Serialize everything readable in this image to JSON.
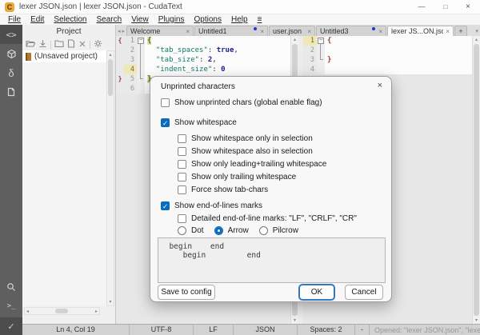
{
  "window": {
    "title": "lexer JSON.json | lexer JSON.json - CudaText",
    "app_badge": "C",
    "controls": {
      "minimize": "—",
      "maximize": "□",
      "close": "×"
    }
  },
  "menu": {
    "items": [
      "File",
      "Edit",
      "Selection",
      "Search",
      "View",
      "Plugins",
      "Options",
      "Help",
      "≡"
    ]
  },
  "icons": {
    "up": "▴",
    "down": "▾",
    "left": "◂",
    "right": "▸",
    "close": "×",
    "plus": "+",
    "overflow": "▾",
    "fold_minus": "−",
    "code": "<>",
    "delta": "δ",
    "console": ">_",
    "list": "≡",
    "check": "✓"
  },
  "sidebar": {
    "top": [
      "code-icon",
      "package-icon",
      "delta-icon",
      "document-icon"
    ],
    "bottom": [
      "search-icon",
      "console-icon",
      "list-icon",
      "check-icon"
    ]
  },
  "project": {
    "title": "Project",
    "toolbar": [
      "open-project-icon",
      "import-icon",
      "new-folder-icon",
      "new-file-icon",
      "close-project-icon",
      "settings-icon"
    ],
    "items": [
      {
        "label": "(Unsaved project)",
        "selected": true
      }
    ]
  },
  "tabbar": {
    "tabs": [
      {
        "label": "Welcome",
        "modified": false,
        "active": false
      },
      {
        "label": "Untitled1",
        "modified": true,
        "active": false
      },
      {
        "label": "user.json",
        "modified": false,
        "active": false
      },
      {
        "label": "Untitled3",
        "modified": true,
        "active": false
      },
      {
        "label": "lexer JS...ON.json",
        "modified": false,
        "active": true
      }
    ]
  },
  "editor_left": {
    "numbers": [
      "1",
      "2",
      "3",
      "4",
      "5",
      "6"
    ],
    "current_line": "4",
    "show_marks": true,
    "gutter_marks": {
      "1": "{",
      "5": "}"
    },
    "lines": [
      [
        {
          "t": "{",
          "c": "brace"
        }
      ],
      [
        {
          "t": "  ",
          "c": "plain"
        },
        {
          "t": "\"tab_spaces\"",
          "c": "key"
        },
        {
          "t": ": ",
          "c": "punct"
        },
        {
          "t": "true",
          "c": "bool"
        },
        {
          "t": ",",
          "c": "punct"
        }
      ],
      [
        {
          "t": "  ",
          "c": "plain"
        },
        {
          "t": "\"tab_size\"",
          "c": "key"
        },
        {
          "t": ": ",
          "c": "punct"
        },
        {
          "t": "2",
          "c": "num"
        },
        {
          "t": ",",
          "c": "punct"
        }
      ],
      [
        {
          "t": "  ",
          "c": "plain"
        },
        {
          "t": "\"indent_size\"",
          "c": "key"
        },
        {
          "t": ": ",
          "c": "punct"
        },
        {
          "t": "0",
          "c": "num"
        }
      ],
      [
        {
          "t": "}",
          "c": "brace"
        }
      ],
      []
    ]
  },
  "editor_right": {
    "numbers": [
      "1",
      "2",
      "3",
      "4"
    ],
    "current_line": "1",
    "show_marks": false,
    "gutter_marks": {},
    "lines": [
      [
        {
          "t": "{",
          "c": "brace2"
        }
      ],
      [],
      [
        {
          "t": "}",
          "c": "brace2"
        }
      ],
      []
    ]
  },
  "dialog": {
    "title": "Unprinted characters",
    "close": "×",
    "checkboxes": [
      {
        "label": "Show unprinted chars (global enable flag)",
        "checked": false,
        "indent": 0
      },
      {
        "label": "Show whitespace",
        "checked": true,
        "indent": 0
      },
      {
        "label": "Show whitespace only in selection",
        "checked": false,
        "indent": 1
      },
      {
        "label": "Show whitespace also in selection",
        "checked": false,
        "indent": 1
      },
      {
        "label": "Show only leading+trailing whitespace",
        "checked": false,
        "indent": 1
      },
      {
        "label": "Show only trailing whitespace",
        "checked": false,
        "indent": 1
      },
      {
        "label": "Force show tab-chars",
        "checked": false,
        "indent": 1
      },
      {
        "label": "Show end-of-lines marks",
        "checked": true,
        "indent": 0
      },
      {
        "label": "Detailed end-of-line marks: \"LF\", \"CRLF\", \"CR\"",
        "checked": false,
        "indent": 1
      }
    ],
    "radios": [
      {
        "label": "Dot",
        "selected": false
      },
      {
        "label": "Arrow",
        "selected": true
      },
      {
        "label": "Pilcrow",
        "selected": false
      }
    ],
    "preview_lines": [
      "  begin    end",
      "     begin         end"
    ],
    "buttons": {
      "save": "Save to config",
      "ok": "OK",
      "cancel": "Cancel"
    }
  },
  "statusbar": {
    "cells": [
      "Ln 4, Col 19",
      "UTF-8",
      "LF",
      "JSON",
      "Spaces: 2",
      "-"
    ],
    "message": "Opened: \"lexer JSON.json\", \"lexer JSON.json\""
  },
  "colors": {
    "accent": "#0b6cbe",
    "app_icon": "#eda93c",
    "modified_dot": "#2733c9",
    "json_key": "#0f7a66",
    "json_number": "#19228f",
    "brace_match_bg": "#dfe2a9",
    "brace_unmatched": "#a03a2e",
    "sidebar_bg": "#5f5f5f"
  }
}
